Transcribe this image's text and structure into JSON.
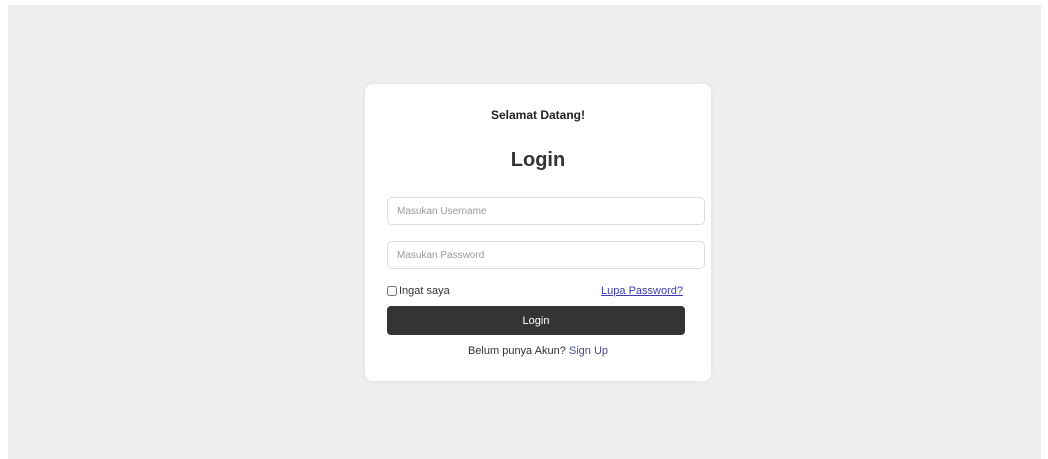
{
  "card": {
    "greeting": "Selamat Datang!",
    "title": "Login",
    "username_placeholder": "Masukan Username",
    "password_placeholder": "Masukan Password",
    "remember_label": "Ingat saya",
    "forgot_label": "Lupa Password?",
    "login_button": "Login",
    "signup_prompt": "Belum punya Akun?",
    "signup_link": "Sign Up"
  }
}
